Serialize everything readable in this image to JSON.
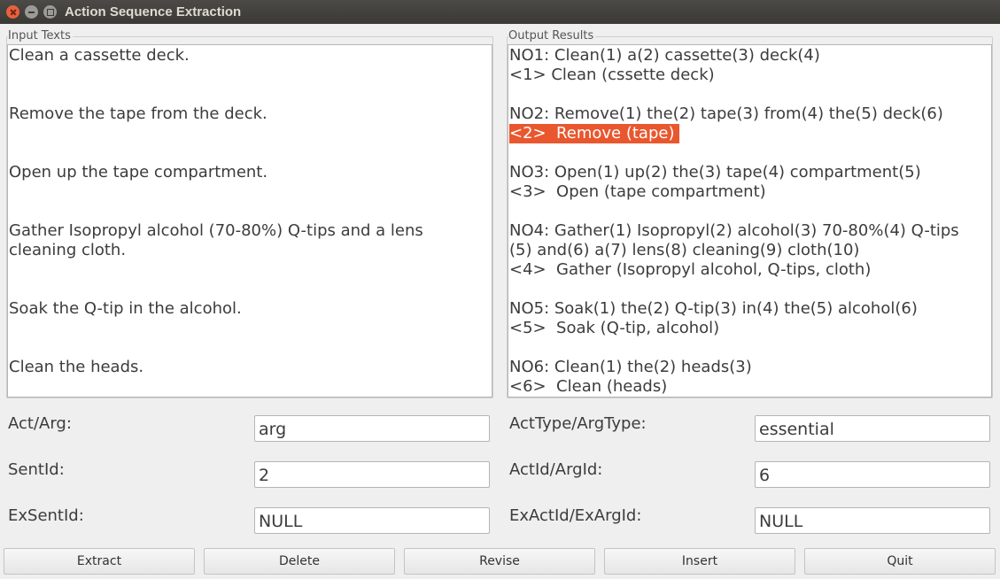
{
  "window": {
    "title": "Action Sequence Extraction"
  },
  "input_group": {
    "label": "Input Texts",
    "lines": [
      "Clean a cassette deck.",
      "",
      "",
      "Remove the tape from the deck.",
      "",
      "",
      "Open up the tape compartment.",
      "",
      "",
      "Gather Isopropyl alcohol (70-80%) Q-tips and a lens",
      "cleaning cloth.",
      "",
      "",
      "Soak the Q-tip in the alcohol.",
      "",
      "",
      "Clean the heads."
    ]
  },
  "output_group": {
    "label": "Output Results",
    "lines": [
      "NO1: Clean(1) a(2) cassette(3) deck(4)",
      "<1> Clean (cssette deck)",
      "",
      "NO2: Remove(1) the(2) tape(3) from(4) the(5) deck(6)",
      "<2>  Remove (tape) ",
      "",
      "NO3: Open(1) up(2) the(3) tape(4) compartment(5)",
      "<3>  Open (tape compartment)",
      "",
      "NO4: Gather(1) Isopropyl(2) alcohol(3) 70-80%(4) Q-tips",
      "(5) and(6) a(7) lens(8) cleaning(9) cloth(10)",
      "<4>  Gather (Isopropyl alcohol, Q-tips, cloth)",
      "",
      "NO5: Soak(1) the(2) Q-tip(3) in(4) the(5) alcohol(6)",
      "<5>  Soak (Q-tip, alcohol)",
      "",
      "NO6: Clean(1) the(2) heads(3)",
      "<6>  Clean (heads)"
    ],
    "highlight_color": "#e9572e"
  },
  "fields": {
    "act_arg": {
      "label": "Act/Arg:",
      "value": "arg"
    },
    "sent_id": {
      "label": "SentId:",
      "value": "2"
    },
    "ex_sent_id": {
      "label": "ExSentId:",
      "value": "NULL"
    },
    "act_type": {
      "label": "ActType/ArgType:",
      "value": "essential"
    },
    "act_id": {
      "label": "ActId/ArgId:",
      "value": "6"
    },
    "ex_act_id": {
      "label": "ExActId/ExArgId:",
      "value": "NULL"
    }
  },
  "buttons": {
    "extract": "Extract",
    "delete": "Delete",
    "revise": "Revise",
    "insert": "Insert",
    "quit": "Quit"
  }
}
